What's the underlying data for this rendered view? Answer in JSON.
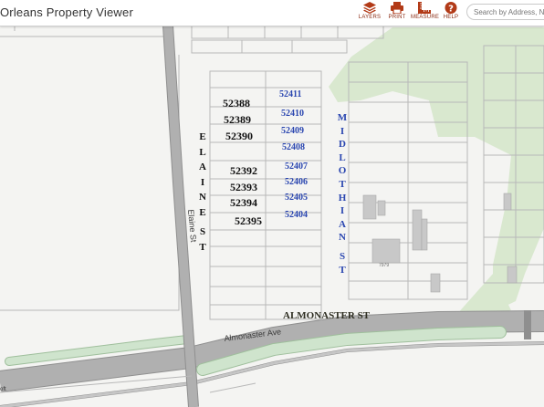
{
  "header": {
    "title": "Orleans Property Viewer",
    "tools": [
      {
        "label": "LAYERS",
        "icon": "layers-icon"
      },
      {
        "label": "PRINT",
        "icon": "printer-icon"
      },
      {
        "label": "MEASURE",
        "icon": "ruler-icon"
      },
      {
        "label": "HELP",
        "icon": "help-icon"
      }
    ],
    "search_placeholder": "Search by Address, N"
  },
  "colors": {
    "accent": "#b23a17",
    "park": "#d9e8cf",
    "road": "#8f8f8f",
    "lot_line": "#b8b8b8",
    "median": "#cfe4cd",
    "lot_blue": "#2a46b0"
  },
  "map": {
    "lot_numbers_west": [
      "52388",
      "52389",
      "52390",
      "52392",
      "52393",
      "52394",
      "52395"
    ],
    "lot_numbers_east": [
      "52411",
      "52410",
      "52409",
      "52408",
      "52407",
      "52406",
      "52405",
      "52404"
    ],
    "street_labels": {
      "elaine_vertical": [
        "E",
        "L",
        "A",
        "I",
        "N",
        "E",
        "S",
        "T"
      ],
      "midlothian_vertical": [
        "M",
        "I",
        "D",
        "L",
        "O",
        "T",
        "H",
        "I",
        "A",
        "N",
        "S",
        "T"
      ],
      "almonaster_overlay": "ALMONASTER ST",
      "elaine_road": "Elaine St",
      "almonaster_road": "Almonaster Ave"
    },
    "address_label": "7979",
    "left_edge_text": "oft"
  }
}
